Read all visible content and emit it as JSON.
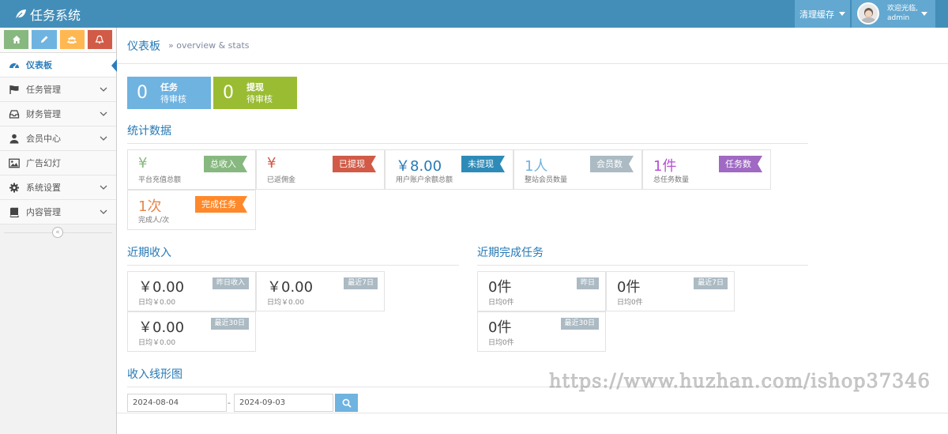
{
  "app": {
    "brand": "任务系统"
  },
  "header": {
    "clear_cache": "清理缓存",
    "welcome": "欢迎光临,",
    "username": "admin"
  },
  "sidebar": {
    "items": [
      {
        "label": "仪表板",
        "icon": "dashboard-icon",
        "active": true
      },
      {
        "label": "任务管理",
        "icon": "flag-icon",
        "active": false
      },
      {
        "label": "财务管理",
        "icon": "inbox-icon",
        "active": false
      },
      {
        "label": "会员中心",
        "icon": "user-icon",
        "active": false
      },
      {
        "label": "广告幻灯",
        "icon": "picture-icon",
        "active": false
      },
      {
        "label": "系统设置",
        "icon": "gear-icon",
        "active": false
      },
      {
        "label": "内容管理",
        "icon": "book-icon",
        "active": false
      }
    ],
    "collapse_symbol": "«"
  },
  "breadcrumb": {
    "title": "仪表板",
    "subtitle": "» overview & stats"
  },
  "pending": [
    {
      "count": "0",
      "title": "任务",
      "sub": "待审核",
      "color": "#6fb3e0"
    },
    {
      "count": "0",
      "title": "提现",
      "sub": "待审核",
      "color": "#9abc32"
    }
  ],
  "stats": {
    "title": "统计数据",
    "cards": [
      {
        "value": "¥",
        "desc": "平台充值总额",
        "tag": "总收入",
        "tag_color": "#87b87f",
        "value_color": "#87b87f"
      },
      {
        "value": "¥",
        "desc": "已返佣金",
        "tag": "已提现",
        "tag_color": "#d15b47",
        "value_color": "#d15b47"
      },
      {
        "value": "￥8.00",
        "desc": "用户账户余额总额",
        "tag": "未提现",
        "tag_color": "#2e8bb8",
        "value_color": "#2679b5"
      },
      {
        "value": "1人",
        "desc": "整站会员数量",
        "tag": "会员数",
        "tag_color": "#abbac3",
        "value_color": "#6fb3e0"
      },
      {
        "value": "1件",
        "desc": "总任务数量",
        "tag": "任务数",
        "tag_color": "#a069c3",
        "value_color": "#b74fd4"
      },
      {
        "value": "1次",
        "desc": "完成人/次",
        "tag": "完成任务",
        "tag_color": "#ff892a",
        "value_color": "#e8864d"
      }
    ]
  },
  "income": {
    "title": "近期收入",
    "cards": [
      {
        "value": "￥0.00",
        "desc": "日均￥0.00",
        "badge": "昨日收入"
      },
      {
        "value": "￥0.00",
        "desc": "日均￥0.00",
        "badge": "最近7日"
      },
      {
        "value": "￥0.00",
        "desc": "日均￥0.00",
        "badge": "最近30日"
      }
    ]
  },
  "tasks": {
    "title": "近期完成任务",
    "cards": [
      {
        "value": "0件",
        "desc": "日均0件",
        "badge": "昨日"
      },
      {
        "value": "0件",
        "desc": "日均0件",
        "badge": "最近7日"
      },
      {
        "value": "0件",
        "desc": "日均0件",
        "badge": "最近30日"
      }
    ]
  },
  "chart": {
    "title": "收入线形图",
    "start_date": "2024-08-04",
    "separator": "-",
    "end_date": "2024-09-03"
  },
  "watermark": "https://www.huzhan.com/ishop37346"
}
